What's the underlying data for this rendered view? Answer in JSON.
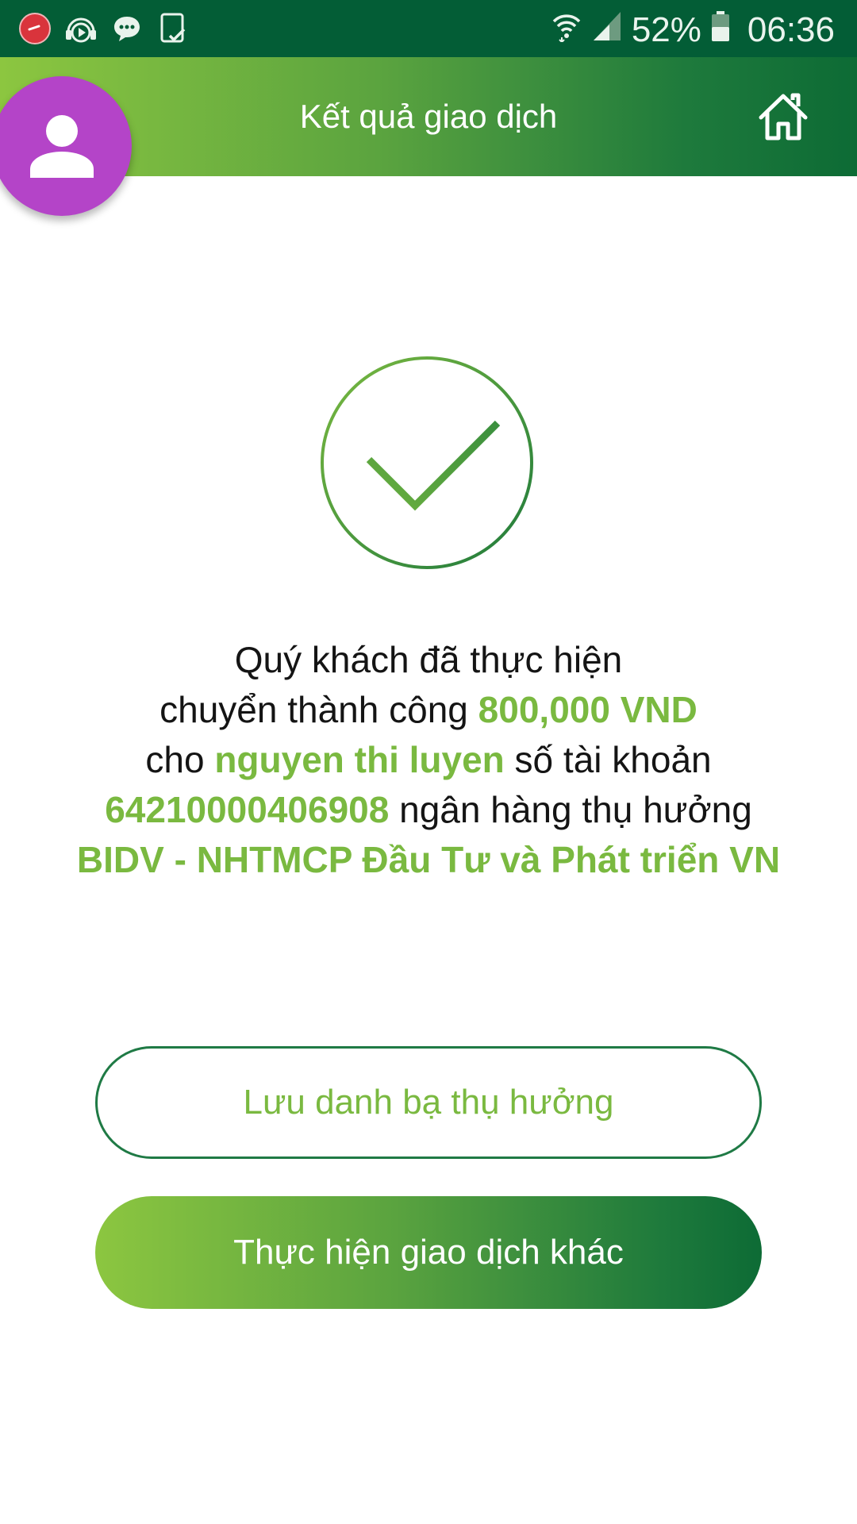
{
  "status_bar": {
    "battery_percent": "52%",
    "time": "06:36",
    "icons": [
      "record-icon",
      "media-icon",
      "chat-icon",
      "task-icon",
      "wifi-icon",
      "signal-icon",
      "battery-icon"
    ]
  },
  "header": {
    "title": "Kết quả giao dịch",
    "home_icon": "home-icon",
    "avatar_icon": "person-icon",
    "gradient_colors": [
      "#8cc640",
      "#0d6b35"
    ]
  },
  "result": {
    "icon": "check-circle-icon",
    "line1": "Quý khách đã thực hiện",
    "line2_prefix": "chuyển thành công ",
    "amount": "800,000 VND",
    "line3_prefix": "cho ",
    "recipient_name": "nguyen thi luyen",
    "line3_suffix": " số tài khoản",
    "account_number": "64210000406908",
    "line4_suffix": " ngân hàng thụ hưởng",
    "bank_name": "BIDV - NHTMCP Đầu Tư và Phát triển VN",
    "highlight_color": "#7ab940"
  },
  "actions": {
    "save_beneficiary_label": "Lưu danh bạ thụ hưởng",
    "new_transaction_label": "Thực hiện giao dịch khác"
  }
}
